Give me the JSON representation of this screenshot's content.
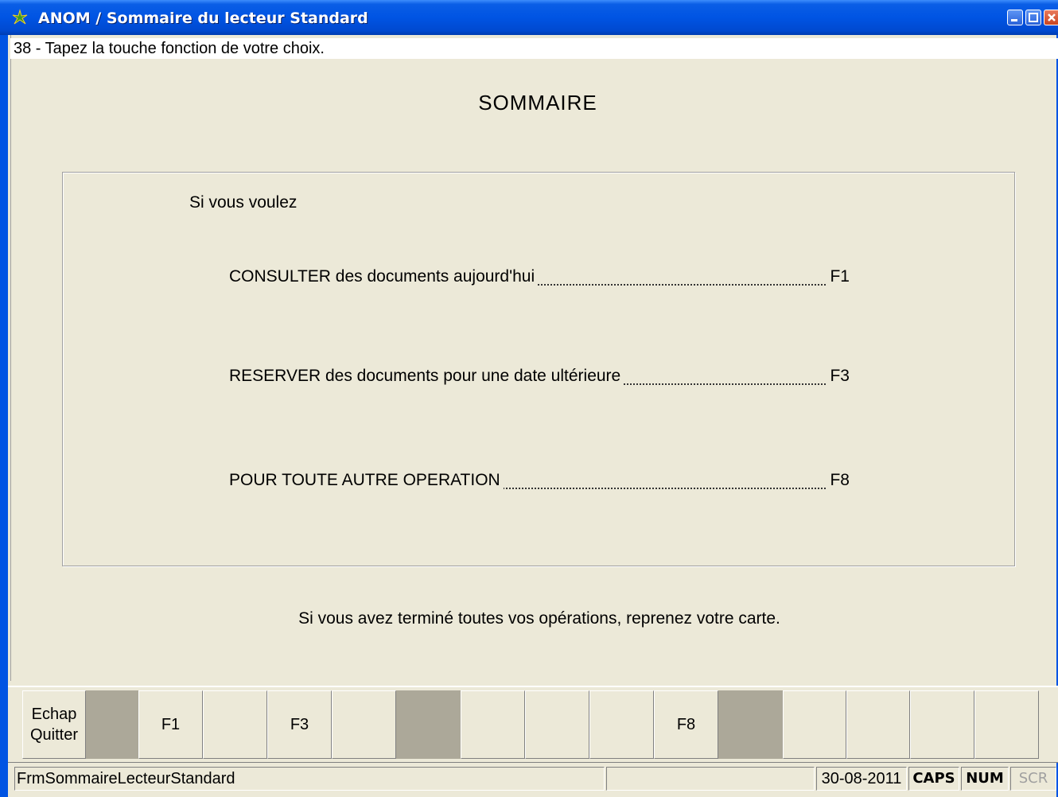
{
  "window": {
    "title": "ANOM / Sommaire du lecteur Standard"
  },
  "message_bar": {
    "text": "38 - Tapez la touche fonction de votre choix."
  },
  "page": {
    "title": "SOMMAIRE",
    "intro": "Si vous voulez",
    "options": [
      {
        "label": "CONSULTER des documents aujourd'hui",
        "key": "F1"
      },
      {
        "label": "RESERVER des documents pour une date ultérieure",
        "key": "F3"
      },
      {
        "label": "POUR TOUTE AUTRE OPERATION",
        "key": "F8"
      }
    ],
    "footer": "Si vous avez terminé toutes vos opérations, reprenez votre carte."
  },
  "function_keys": [
    {
      "label": "Echap\nQuitter",
      "enabled": true
    },
    {
      "label": "",
      "enabled": false
    },
    {
      "label": "F1",
      "enabled": true
    },
    {
      "label": "",
      "enabled": true
    },
    {
      "label": "F3",
      "enabled": true
    },
    {
      "label": "",
      "enabled": true
    },
    {
      "label": "",
      "enabled": false
    },
    {
      "label": "",
      "enabled": true
    },
    {
      "label": "",
      "enabled": true
    },
    {
      "label": "",
      "enabled": true
    },
    {
      "label": "F8",
      "enabled": true
    },
    {
      "label": "",
      "enabled": false
    },
    {
      "label": "",
      "enabled": true
    },
    {
      "label": "",
      "enabled": true
    },
    {
      "label": "",
      "enabled": true
    },
    {
      "label": "",
      "enabled": true
    }
  ],
  "status_bar": {
    "form_name": "FrmSommaireLecteurStandard",
    "middle": "",
    "date": "30-08-2011",
    "caps": "CAPS",
    "num": "NUM",
    "scr": "SCR"
  },
  "colors": {
    "face": "#ece9d8",
    "titlebar": "#0054e3",
    "disabled_key": "#aca899"
  }
}
